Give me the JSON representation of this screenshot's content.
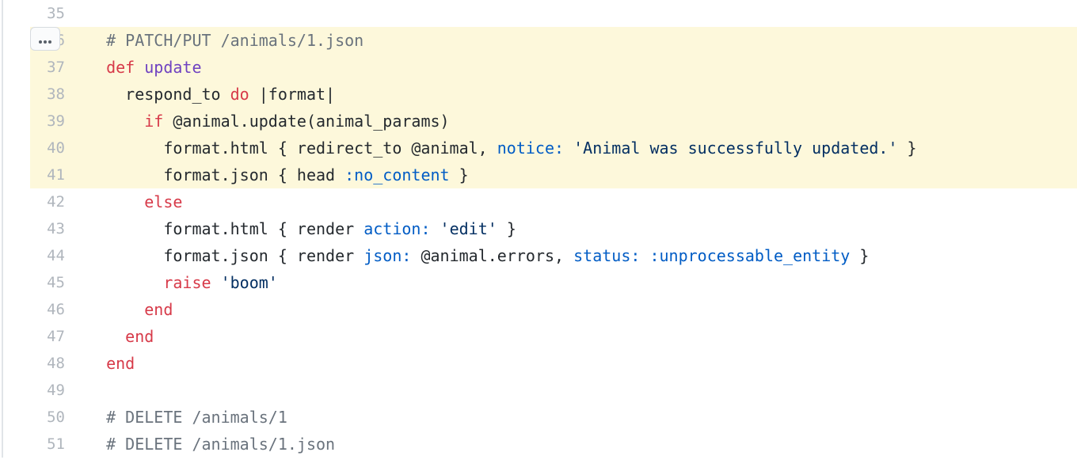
{
  "more_button_label": "more-actions",
  "lines": [
    {
      "n": 35,
      "hl": false,
      "indent": 0,
      "tokens": []
    },
    {
      "n": 36,
      "hl": true,
      "indent": 2,
      "tokens": [
        [
          "comment",
          "# PATCH/PUT /animals/1.json"
        ]
      ]
    },
    {
      "n": 37,
      "hl": true,
      "indent": 2,
      "tokens": [
        [
          "kw",
          "def "
        ],
        [
          "def",
          "update"
        ]
      ]
    },
    {
      "n": 38,
      "hl": true,
      "indent": 4,
      "tokens": [
        [
          "plain",
          "respond_to "
        ],
        [
          "kw",
          "do"
        ],
        [
          "plain",
          " |format|"
        ]
      ]
    },
    {
      "n": 39,
      "hl": true,
      "indent": 6,
      "tokens": [
        [
          "kw",
          "if"
        ],
        [
          "plain",
          " @animal.update(animal_params)"
        ]
      ]
    },
    {
      "n": 40,
      "hl": true,
      "indent": 8,
      "tokens": [
        [
          "plain",
          "format.html { redirect_to @animal, "
        ],
        [
          "sym",
          "notice:"
        ],
        [
          "plain",
          " "
        ],
        [
          "str",
          "'Animal was successfully updated.'"
        ],
        [
          "plain",
          " }"
        ]
      ]
    },
    {
      "n": 41,
      "hl": true,
      "indent": 8,
      "tokens": [
        [
          "plain",
          "format.json { head "
        ],
        [
          "sym",
          ":no_content"
        ],
        [
          "plain",
          " }"
        ]
      ]
    },
    {
      "n": 42,
      "hl": false,
      "indent": 6,
      "tokens": [
        [
          "kw",
          "else"
        ]
      ]
    },
    {
      "n": 43,
      "hl": false,
      "indent": 8,
      "tokens": [
        [
          "plain",
          "format.html { render "
        ],
        [
          "sym",
          "action:"
        ],
        [
          "plain",
          " "
        ],
        [
          "str",
          "'edit'"
        ],
        [
          "plain",
          " }"
        ]
      ]
    },
    {
      "n": 44,
      "hl": false,
      "indent": 8,
      "tokens": [
        [
          "plain",
          "format.json { render "
        ],
        [
          "sym",
          "json:"
        ],
        [
          "plain",
          " @animal.errors, "
        ],
        [
          "sym",
          "status:"
        ],
        [
          "plain",
          " "
        ],
        [
          "sym",
          ":unprocessable_entity"
        ],
        [
          "plain",
          " }"
        ]
      ]
    },
    {
      "n": 45,
      "hl": false,
      "indent": 8,
      "tokens": [
        [
          "raise",
          "raise"
        ],
        [
          "plain",
          " "
        ],
        [
          "str",
          "'boom'"
        ]
      ]
    },
    {
      "n": 46,
      "hl": false,
      "indent": 6,
      "tokens": [
        [
          "kw",
          "end"
        ]
      ]
    },
    {
      "n": 47,
      "hl": false,
      "indent": 4,
      "tokens": [
        [
          "kw",
          "end"
        ]
      ]
    },
    {
      "n": 48,
      "hl": false,
      "indent": 2,
      "tokens": [
        [
          "kw",
          "end"
        ]
      ]
    },
    {
      "n": 49,
      "hl": false,
      "indent": 0,
      "tokens": []
    },
    {
      "n": 50,
      "hl": false,
      "indent": 2,
      "tokens": [
        [
          "comment",
          "# DELETE /animals/1"
        ]
      ]
    },
    {
      "n": 51,
      "hl": false,
      "indent": 2,
      "tokens": [
        [
          "comment",
          "# DELETE /animals/1.json"
        ]
      ]
    }
  ]
}
